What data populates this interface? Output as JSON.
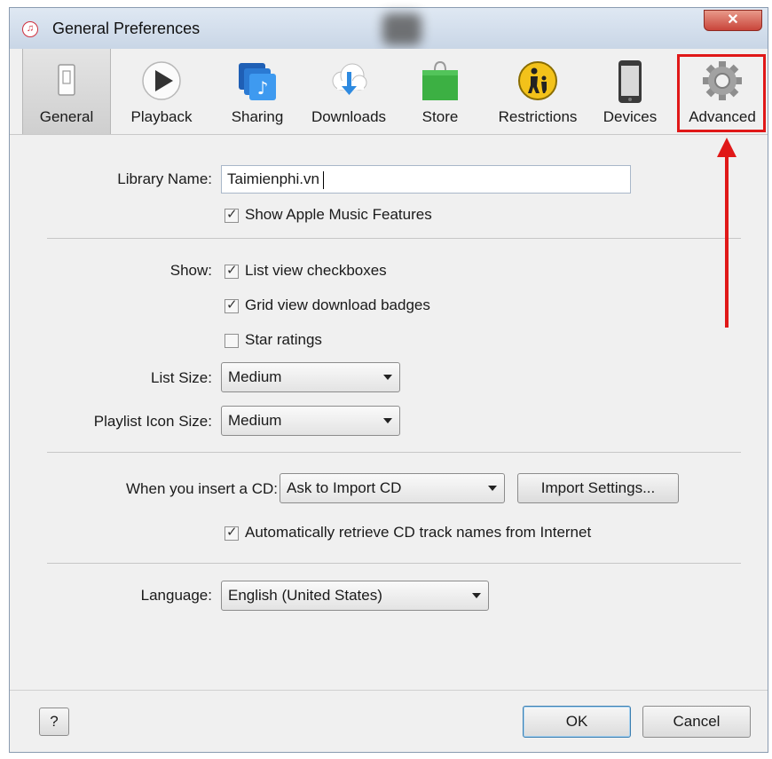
{
  "window": {
    "title": "General Preferences",
    "close_glyph": "✕"
  },
  "toolbar": {
    "items": [
      {
        "label": "General",
        "icon": "general-icon",
        "selected": true
      },
      {
        "label": "Playback",
        "icon": "play-icon"
      },
      {
        "label": "Sharing",
        "icon": "sharing-icon"
      },
      {
        "label": "Downloads",
        "icon": "download-cloud-icon"
      },
      {
        "label": "Store",
        "icon": "store-bag-icon"
      },
      {
        "label": "Restrictions",
        "icon": "restrictions-icon"
      },
      {
        "label": "Devices",
        "icon": "phone-icon"
      },
      {
        "label": "Advanced",
        "icon": "gear-icon"
      }
    ]
  },
  "library": {
    "label": "Library Name:",
    "value": "Taimienphi.vn",
    "show_apple_music": {
      "label": "Show Apple Music Features",
      "checked": true
    }
  },
  "show": {
    "label": "Show:",
    "options": [
      {
        "label": "List view checkboxes",
        "checked": true
      },
      {
        "label": "Grid view download badges",
        "checked": true
      },
      {
        "label": "Star ratings",
        "checked": false
      }
    ]
  },
  "list_size": {
    "label": "List Size:",
    "value": "Medium"
  },
  "playlist_icon_size": {
    "label": "Playlist Icon Size:",
    "value": "Medium"
  },
  "cd": {
    "label": "When you insert a CD:",
    "value": "Ask to Import CD",
    "import_settings_button": "Import Settings...",
    "auto_retrieve": {
      "label": "Automatically retrieve CD track names from Internet",
      "checked": true
    }
  },
  "language": {
    "label": "Language:",
    "value": "English (United States)"
  },
  "footer": {
    "help_button": "?",
    "ok_button": "OK",
    "cancel_button": "Cancel"
  },
  "colors": {
    "annotation": "#e01818",
    "default_button_border": "#3c7fb1"
  }
}
